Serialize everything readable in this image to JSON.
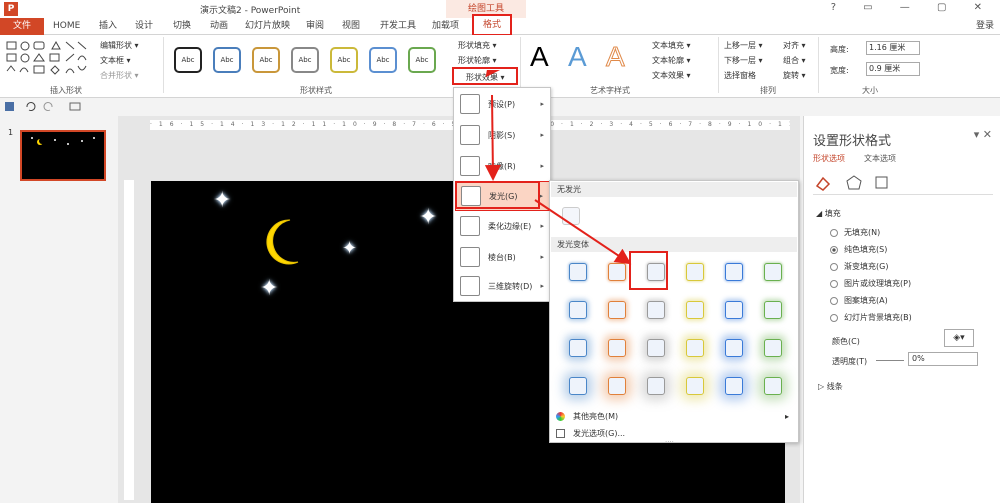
{
  "title_bar": {
    "app_icon": "P",
    "document_title": "演示文稿2 - PowerPoint",
    "context_tab_group": "绘图工具",
    "window_controls": "? ▭ — ▢ ✕"
  },
  "tabs": {
    "file": "文件",
    "items": [
      "HOME",
      "插入",
      "设计",
      "切换",
      "动画",
      "幻灯片放映",
      "审阅",
      "视图",
      "开发工具",
      "加载项"
    ],
    "format": "格式",
    "login": "登录"
  },
  "ribbon": {
    "insert_shapes": {
      "edit_shape": "编辑形状 ▾",
      "text_box": "文本框 ▾",
      "merge_shapes": "合并形状 ▾",
      "label": "插入形状"
    },
    "shape_styles": {
      "sample": "Abc",
      "border_colors": [
        "#222222",
        "#4a7ebb",
        "#c9973a",
        "#888888",
        "#cbb93a",
        "#5b8fd1",
        "#6aa84f"
      ],
      "fill": "形状填充 ▾",
      "outline": "形状轮廓 ▾",
      "effects": "形状效果 ▾",
      "label": "形状样式"
    },
    "wordart": {
      "letter": "A",
      "text_fill": "文本填充 ▾",
      "text_outline": "文本轮廓 ▾",
      "text_effects": "文本效果 ▾",
      "label": "艺术字样式"
    },
    "arrange": {
      "bring_forward": "上移一层 ▾",
      "send_backward": "下移一层 ▾",
      "selection_pane": "选择窗格",
      "align": "对齐 ▾",
      "group": "组合 ▾",
      "rotate": "旋转 ▾",
      "label": "排列"
    },
    "size": {
      "height_label": "高度:",
      "height_value": "1.16 厘米",
      "width_label": "宽度:",
      "width_value": "0.9 厘米",
      "label": "大小"
    }
  },
  "ruler": "·16·15·14·13·12·11·10·9·8·7·6·5·4·3·2·1·0·1·2·3·4·5·6·7·8·9·10·11·12·13·14·15·16·",
  "thumbnail": {
    "number": "1"
  },
  "effects_menu": [
    {
      "label": "预设(P)",
      "arrow": "▸"
    },
    {
      "label": "阴影(S)",
      "arrow": "▸"
    },
    {
      "label": "映像(R)",
      "arrow": "▸"
    },
    {
      "label": "发光(G)",
      "arrow": "▸"
    },
    {
      "label": "柔化边缘(E)",
      "arrow": "▸"
    },
    {
      "label": "棱台(B)",
      "arrow": "▸"
    },
    {
      "label": "三维旋转(D)",
      "arrow": "▸"
    }
  ],
  "glow_menu": {
    "no_glow_header": "无发光",
    "variants_header": "发光变体",
    "glow_colors": [
      "#4a86c8",
      "#e0803a",
      "#9a9a9a",
      "#d8c83a",
      "#3a7ad8",
      "#6ab04f"
    ],
    "more_colors": "其他亮色(M)",
    "more_colors_arrow": "▸",
    "glow_options": "发光选项(G)...",
    "grip": "····"
  },
  "format_pane": {
    "title": "设置形状格式",
    "tab_shape": "形状选项",
    "tab_text": "文本选项",
    "fill_section": "填充",
    "fill_options": [
      "无填充(N)",
      "纯色填充(S)",
      "渐变填充(G)",
      "图片或纹理填充(P)",
      "图案填充(A)",
      "幻灯片背景填充(B)"
    ],
    "selected_option": 1,
    "color_label": "颜色(C)",
    "transparency_label": "透明度(T)",
    "transparency_value": "0%",
    "line_section": "线条"
  }
}
